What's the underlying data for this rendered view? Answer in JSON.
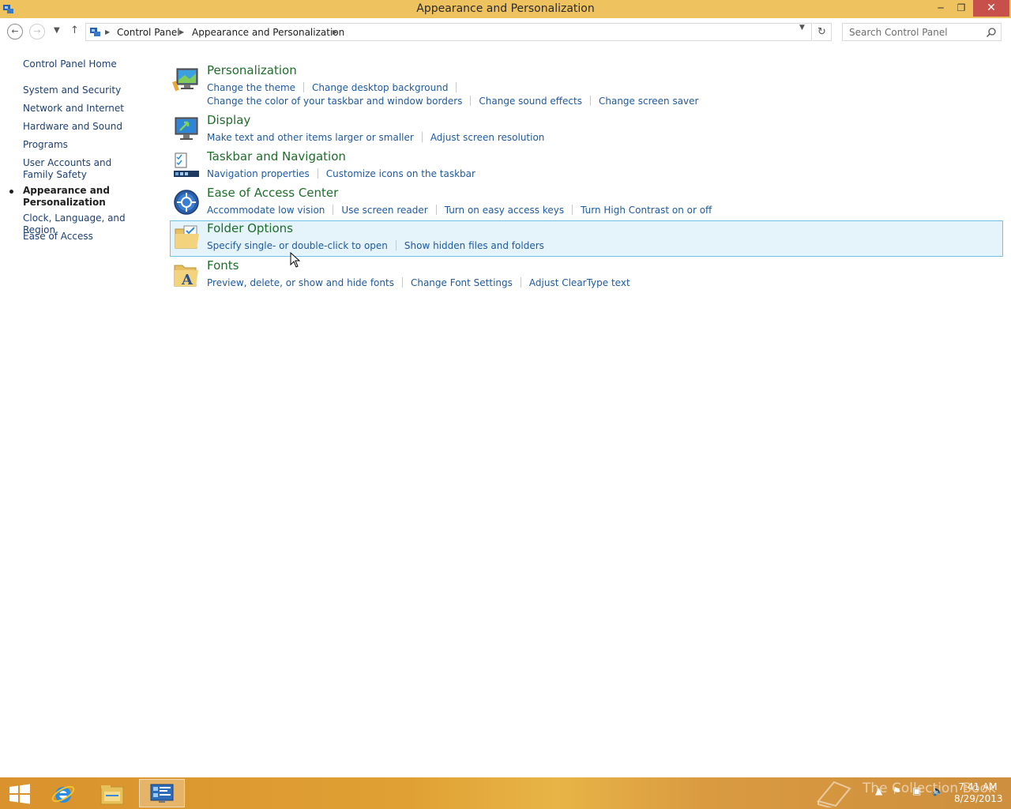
{
  "window": {
    "title": "Appearance and Personalization",
    "minimize_label": "─",
    "maximize_label": "❐",
    "close_label": "✕"
  },
  "address": {
    "breadcrumbs": [
      "Control Panel",
      "Appearance and Personalization"
    ],
    "search_placeholder": "Search Control Panel"
  },
  "sidebar": {
    "items": [
      {
        "label": "Control Panel Home"
      },
      {
        "label": "System and Security"
      },
      {
        "label": "Network and Internet"
      },
      {
        "label": "Hardware and Sound"
      },
      {
        "label": "Programs"
      },
      {
        "label": "User Accounts and Family Safety"
      },
      {
        "label": "Appearance and Personalization",
        "current": true
      },
      {
        "label": "Clock, Language, and Region"
      },
      {
        "label": "Ease of Access"
      }
    ]
  },
  "categories": [
    {
      "title": "Personalization",
      "icon": "personalization-icon",
      "links": [
        "Change the theme",
        "Change desktop background"
      ],
      "links_row2": [
        "Change the color of your taskbar and window borders",
        "Change sound effects",
        "Change screen saver"
      ]
    },
    {
      "title": "Display",
      "icon": "display-icon",
      "links": [
        "Make text and other items larger or smaller",
        "Adjust screen resolution"
      ]
    },
    {
      "title": "Taskbar and Navigation",
      "icon": "taskbar-icon",
      "links": [
        "Navigation properties",
        "Customize icons on the taskbar"
      ]
    },
    {
      "title": "Ease of Access Center",
      "icon": "ease-of-access-icon",
      "links": [
        "Accommodate low vision",
        "Use screen reader",
        "Turn on easy access keys",
        "Turn High Contrast on or off"
      ]
    },
    {
      "title": "Folder Options",
      "icon": "folder-options-icon",
      "links": [
        "Specify single- or double-click to open",
        "Show hidden files and folders"
      ]
    },
    {
      "title": "Fonts",
      "icon": "fonts-icon",
      "links": [
        "Preview, delete, or show and hide fonts",
        "Change Font Settings",
        "Adjust ClearType text"
      ]
    }
  ],
  "taskbar": {
    "time": "7:41 AM",
    "date": "8/29/2013",
    "watermark": "The Collection Book"
  },
  "colors": {
    "titlebar": "#eec25f",
    "category_title": "#1e6e2a",
    "link": "#1e5aa0",
    "hover_bg": "#e5f3fb"
  }
}
